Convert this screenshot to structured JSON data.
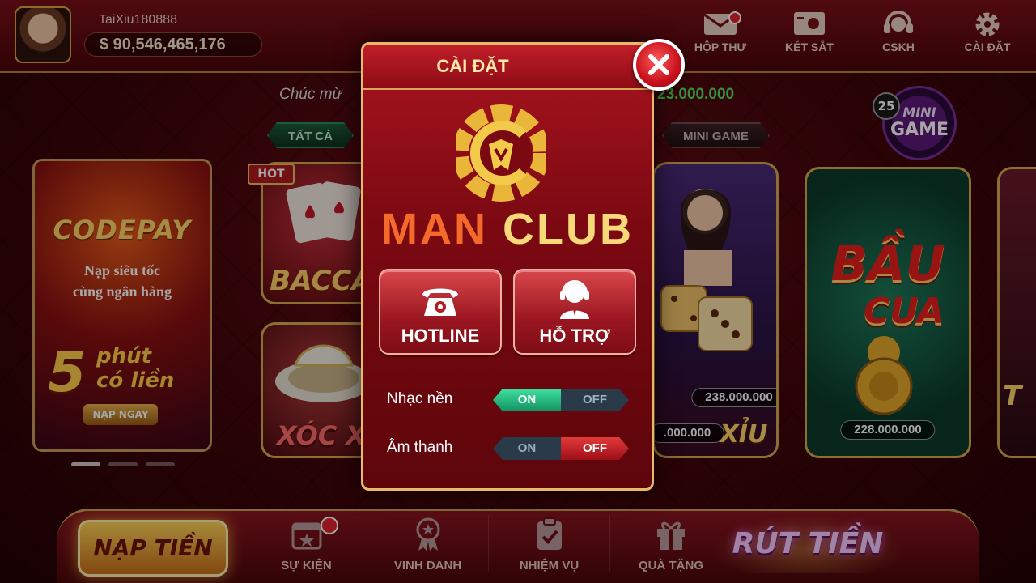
{
  "user": {
    "name": "TaiXiu180888",
    "balance": "$ 90,546,465,176"
  },
  "top_nav": [
    {
      "label": "HỘP THƯ",
      "icon": "mail-icon"
    },
    {
      "label": "KÉT SẮT",
      "icon": "safe-icon"
    },
    {
      "label": "CSKH",
      "icon": "headset-icon"
    },
    {
      "label": "CÀI ĐẶT",
      "icon": "gear-icon"
    }
  ],
  "marquee": {
    "left": "Chúc mừ",
    "right": "23.000.000"
  },
  "tabs": {
    "all": "TẤT CẢ",
    "mini": "MINI GAME"
  },
  "mini_game": {
    "line1": "MINI",
    "line2": "GAME",
    "badge": "25"
  },
  "banner": {
    "title": "CODEPAY",
    "sub1": "Nạp siêu tốc",
    "sub2": "cùng ngân hàng",
    "num": "5",
    "unit1": "phút",
    "unit2": "có liền",
    "button": "NẠP NGAY"
  },
  "games": {
    "hot": "HOT",
    "baccarat": "BACCA",
    "xocxoc": "XÓC X",
    "taixiu_jackpot1": "238.000.000",
    "taixiu_jackpot2": ".000.000",
    "taixiu_name": "XỈU",
    "baucua_name1": "BẦU",
    "baucua_name2": "CUA",
    "baucua_jackpot": "228.000.000",
    "edge_text": "T"
  },
  "bottom_nav": {
    "deposit": "NẠP TIỀN",
    "withdraw": "RÚT TIỀN",
    "items": [
      {
        "label": "SỰ KIỆN",
        "icon": "calendar-star-icon"
      },
      {
        "label": "VINH DANH",
        "icon": "medal-icon"
      },
      {
        "label": "NHIỆM VỤ",
        "icon": "clipboard-check-icon"
      },
      {
        "label": "QUÀ TẶNG",
        "icon": "gift-icon"
      }
    ]
  },
  "dialog": {
    "title": "CÀI ĐẶT",
    "brand_man": "MAN",
    "brand_club": "CLUB",
    "hotline": "HOTLINE",
    "support": "HỖ TRỢ",
    "music_label": "Nhạc nền",
    "sound_label": "Âm thanh",
    "on": "ON",
    "off": "OFF",
    "music_state": "ON",
    "sound_state": "OFF"
  },
  "colors": {
    "background": "#4a060b",
    "gold": "#e8b969",
    "toggle_on": "#2fd08f",
    "toggle_off": "#d12a33",
    "jackpot_green": "#53e05a"
  }
}
